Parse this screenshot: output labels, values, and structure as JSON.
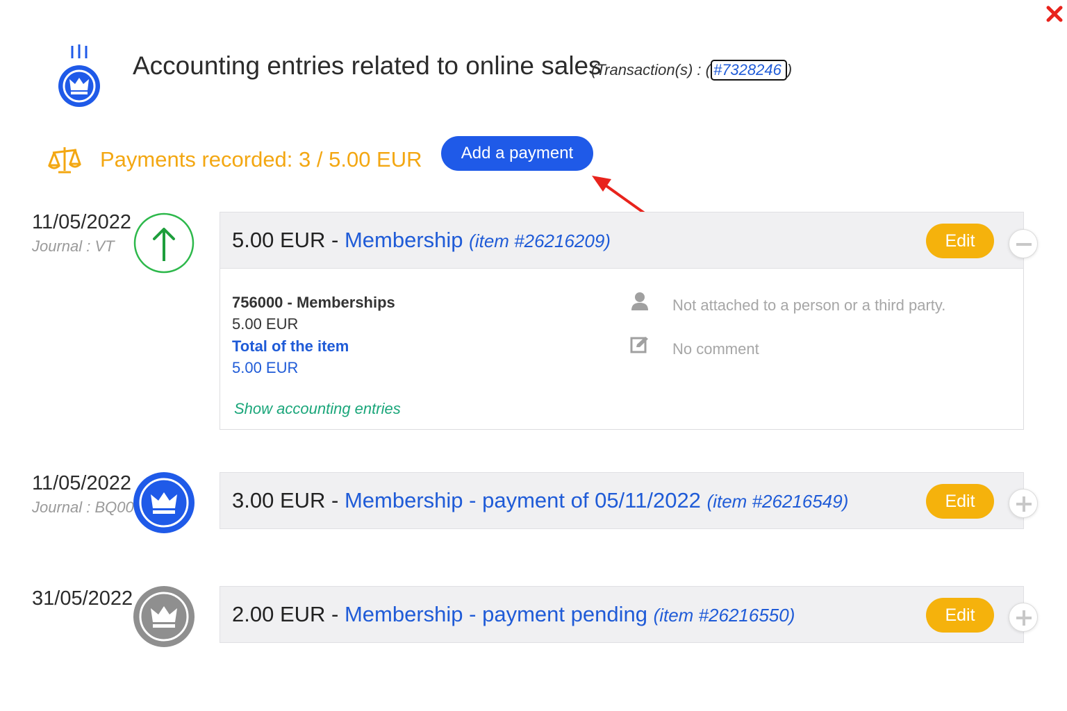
{
  "header": {
    "title": "Accounting entries related to online sales",
    "transaction_prefix": "(Transaction(s) : (",
    "transaction_id": "#7328246",
    "transaction_suffix": ")"
  },
  "summary": {
    "payments_recorded": "Payments recorded: 3 / 5.00 EUR",
    "add_payment_label": "Add a payment"
  },
  "colors": {
    "accent_blue": "#1f5ae8",
    "warning_orange": "#f3a712",
    "edit_yellow": "#f5b20c",
    "success_green": "#1aa67a",
    "close_red": "#e8231c"
  },
  "icons": {
    "close": "close-icon",
    "header": "crown-medal-icon",
    "scales": "scales-icon",
    "person": "person-icon",
    "comment": "edit-note-icon"
  },
  "entries": [
    {
      "date": "11/05/2022",
      "journal": "Journal : VT",
      "status_icon": "arrow-up-icon",
      "amount": "5.00 EUR",
      "separator": "-",
      "label": "Membership",
      "item_ref": "(item #26216209)",
      "edit_label": "Edit",
      "expanded": true,
      "details": {
        "account": "756000 - Memberships",
        "account_amount": "5.00 EUR",
        "total_label": "Total of the item",
        "total_amount": "5.00 EUR",
        "show_entries_label": "Show accounting entries",
        "person_text": "Not attached to a person or a third party.",
        "comment_text": "No comment"
      }
    },
    {
      "date": "11/05/2022",
      "journal": "Journal : BQ004",
      "status_icon": "crown-blue-icon",
      "amount": "3.00 EUR",
      "separator": "-",
      "label": "Membership - payment of 05/11/2022",
      "item_ref": "(item #26216549)",
      "edit_label": "Edit",
      "expanded": false
    },
    {
      "date": "31/05/2022",
      "journal": "",
      "status_icon": "crown-grey-icon",
      "amount": "2.00 EUR",
      "separator": "-",
      "label": "Membership - payment pending",
      "item_ref": "(item #26216550)",
      "edit_label": "Edit",
      "expanded": false
    }
  ]
}
